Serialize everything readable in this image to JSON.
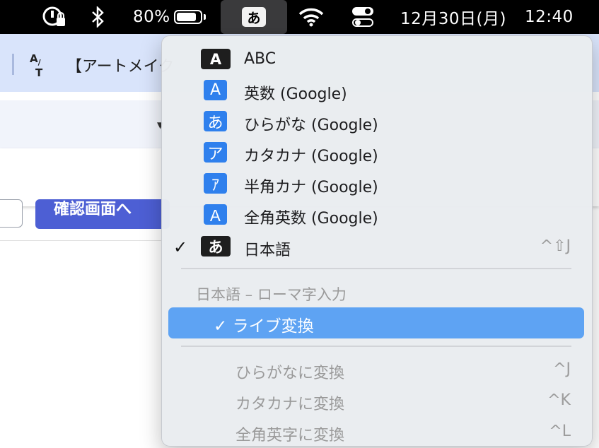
{
  "menubar": {
    "battery_percent": "80%",
    "battery_level": 0.8,
    "input_source_badge": "あ",
    "date": "12月30日(月)",
    "time": "12:40"
  },
  "background_app": {
    "toolbar_title": "【アートメイク",
    "primary_button_label": "確認画面へ"
  },
  "input_menu": {
    "sources": [
      {
        "badge": "A",
        "label": "ABC",
        "style": "dark",
        "checked": false,
        "shortcut": ""
      },
      {
        "badge": "A",
        "label": "英数 (Google)",
        "style": "blue",
        "checked": false,
        "shortcut": ""
      },
      {
        "badge": "あ",
        "label": "ひらがな (Google)",
        "style": "blue",
        "checked": false,
        "shortcut": ""
      },
      {
        "badge": "ア",
        "label": "カタカナ (Google)",
        "style": "blue",
        "checked": false,
        "shortcut": ""
      },
      {
        "badge": "ｱ",
        "label": "半角カナ (Google)",
        "style": "blue",
        "checked": false,
        "shortcut": ""
      },
      {
        "badge": "Ａ",
        "label": "全角英数 (Google)",
        "style": "blue",
        "checked": false,
        "shortcut": ""
      },
      {
        "badge": "あ",
        "label": "日本語",
        "style": "dark",
        "checked": true,
        "shortcut": "^⇧J"
      }
    ],
    "section_header": "日本語 – ローマ字入力",
    "live_conversion": {
      "check": "✓",
      "label": "ライブ変換",
      "checked": true
    },
    "conversions": [
      {
        "label": "ひらがなに変換",
        "shortcut": "^J"
      },
      {
        "label": "カタカナに変換",
        "shortcut": "^K"
      },
      {
        "label": "全角英字に変換",
        "shortcut": "^L"
      }
    ],
    "check_mark": "✓"
  }
}
